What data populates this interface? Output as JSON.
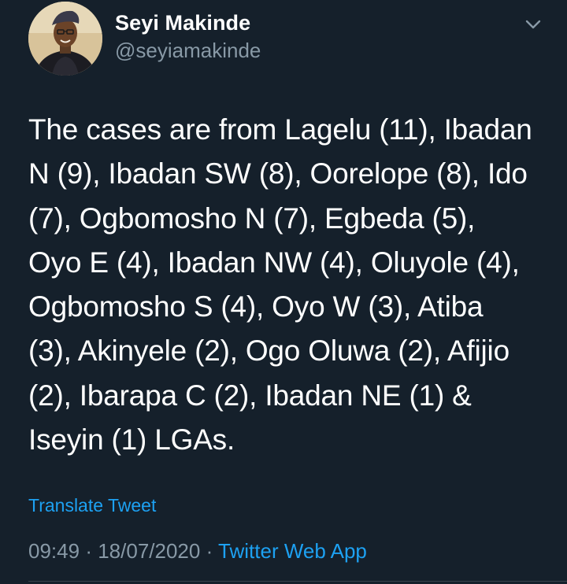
{
  "author": {
    "display_name": "Seyi Makinde",
    "handle": "@seyiamakinde",
    "avatar_icon": "user-avatar-photo"
  },
  "tweet": {
    "text": "The cases are from Lagelu (11), Ibadan\nN (9), Ibadan SW (8), Oorelope (8), Ido\n(7), Ogbomosho N (7), Egbeda (5),\nOyo E (4), Ibadan NW (4), Oluyole (4),\nOgbomosho S (4), Oyo W (3), Atiba\n(3), Akinyele (2), Ogo Oluwa (2), Afijio\n(2), Ibarapa C (2), Ibadan NE (1) &\nIseyin (1) LGAs.",
    "translate_label": "Translate Tweet",
    "time": "09:49",
    "date": "18/07/2020",
    "separator": "·",
    "source": "Twitter Web App"
  },
  "icons": {
    "menu": "chevron-down-icon"
  },
  "colors": {
    "background": "#15202b",
    "link": "#1da1f2",
    "secondary_text": "#8899a6"
  }
}
